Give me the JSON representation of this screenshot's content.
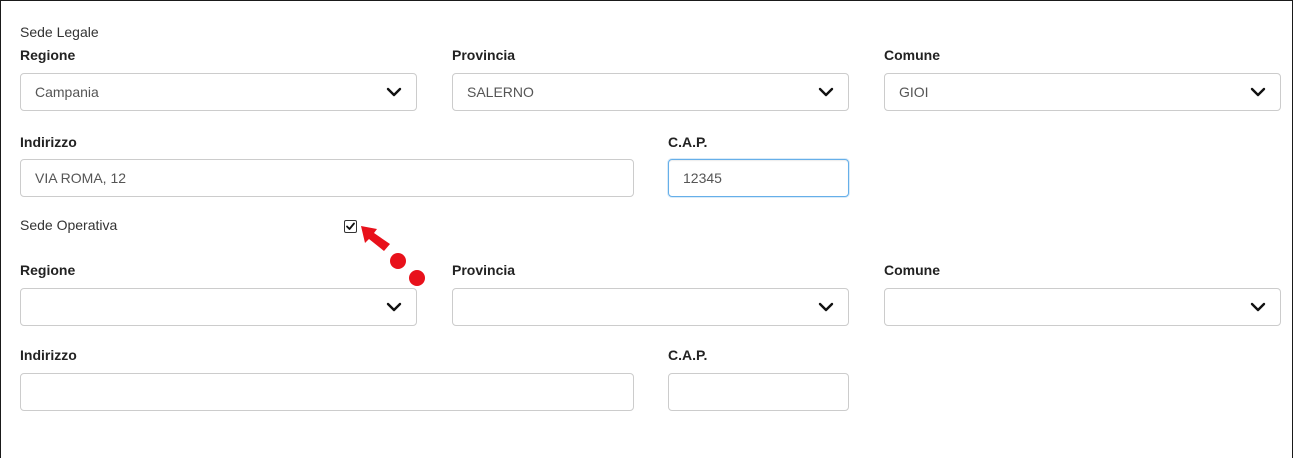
{
  "sede_legale": {
    "title": "Sede Legale",
    "regione": {
      "label": "Regione",
      "value": "Campania"
    },
    "provincia": {
      "label": "Provincia",
      "value": "SALERNO"
    },
    "comune": {
      "label": "Comune",
      "value": "GIOI"
    },
    "indirizzo": {
      "label": "Indirizzo",
      "value": "VIA ROMA, 12"
    },
    "cap": {
      "label": "C.A.P.",
      "value": "12345"
    }
  },
  "sede_operativa": {
    "title": "Sede Operativa",
    "checkbox_checked": true,
    "regione": {
      "label": "Regione",
      "value": ""
    },
    "provincia": {
      "label": "Provincia",
      "value": ""
    },
    "comune": {
      "label": "Comune",
      "value": ""
    },
    "indirizzo": {
      "label": "Indirizzo",
      "value": ""
    },
    "cap": {
      "label": "C.A.P.",
      "value": ""
    }
  },
  "colors": {
    "annotation_red": "#e8111b",
    "focus_border": "#66afe9",
    "field_border": "#cccccc"
  }
}
